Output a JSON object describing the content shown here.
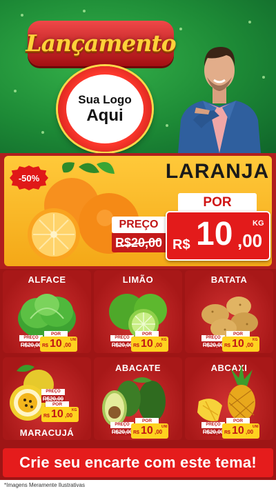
{
  "header": {
    "title": "Lançamento",
    "logo_line1": "Sua Logo",
    "logo_line2": "Aqui",
    "colors": {
      "bg": "#1d8a36",
      "title": "#ffd23a",
      "ribbon": "#d42222"
    }
  },
  "main_deal": {
    "discount": "-50%",
    "name": "LARANJA",
    "por_label": "POR",
    "price_currency": "R$",
    "price_int": "10",
    "price_dec": ",00",
    "price_unit": "KG",
    "old_label": "PREÇO",
    "old_price": "R$20,00"
  },
  "products": [
    {
      "name": "ALFACE",
      "preco": "PREÇO",
      "old": "R$20,00",
      "por": "POR",
      "cur": "R$",
      "int": "10",
      "dec": ",00",
      "unit": "UNI",
      "icon": "lettuce-icon"
    },
    {
      "name": "LIMÃO",
      "preco": "PREÇO",
      "old": "R$20,00",
      "por": "POR",
      "cur": "R$",
      "int": "10",
      "dec": ",00",
      "unit": "KG",
      "icon": "lime-icon"
    },
    {
      "name": "BATATA",
      "preco": "PREÇO",
      "old": "R$20,00",
      "por": "POR",
      "cur": "R$",
      "int": "10",
      "dec": ",00",
      "unit": "KG",
      "icon": "potato-icon"
    },
    {
      "name": "MARACUJÁ",
      "preco": "PREÇO",
      "old": "R$20,00",
      "por": "POR",
      "cur": "R$",
      "int": "10",
      "dec": ",00",
      "unit": "KG",
      "icon": "passion-fruit-icon"
    },
    {
      "name": "ABACATE",
      "preco": "PREÇO",
      "old": "R$20,00",
      "por": "POR",
      "cur": "R$",
      "int": "10",
      "dec": ",00",
      "unit": "UNI",
      "icon": "avocado-icon"
    },
    {
      "name": "ABCAXI",
      "preco": "PREÇO",
      "old": "R$20,00",
      "por": "POR",
      "cur": "R$",
      "int": "10",
      "dec": ",00",
      "unit": "UNI",
      "icon": "pineapple-icon"
    }
  ],
  "cta": "Crie seu encarte com este tema!",
  "footer": "*Imagens Meramente Ilustrativas"
}
